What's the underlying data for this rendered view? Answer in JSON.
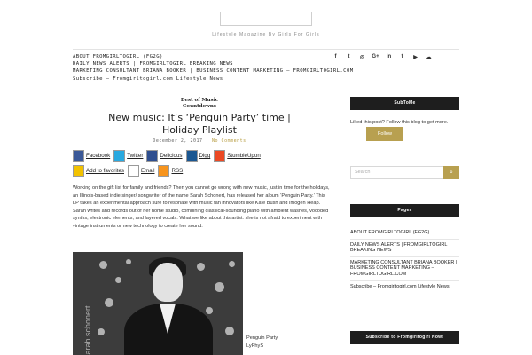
{
  "site": {
    "tagline": "Lifestyle Magazine By Girls For Girls"
  },
  "nav": {
    "links": [
      "ABOUT FROMGIRLTOGIRL (FG2G)",
      "DAILY NEWS ALERTS | FROMGIRLTOGIRL BREAKING NEWS",
      "MARKETING CONSULTANT BRIANA BOOKER | BUSINESS CONTENT MARKETING – FROMGIRLTOGIRL.COM",
      "Subscribe – Fromgirltogirl.com Lifestyle News"
    ],
    "social_icons": [
      "facebook-icon",
      "twitter-icon",
      "instagram-icon",
      "google-plus-icon",
      "linkedin-icon",
      "tumblr-icon",
      "youtube-icon",
      "soundcloud-icon"
    ],
    "social_glyphs": [
      "f",
      "t",
      "◎",
      "G+",
      "in",
      "t",
      "▶",
      "☁"
    ]
  },
  "post": {
    "category_line1": "Best of Music",
    "category_line2": "Countdowns",
    "title_line1": "New music: It’s ‘Penguin Party’ time |",
    "title_line2": "Holiday Playlist",
    "date": "December 2, 2017",
    "comments": "No Comments",
    "body": "Working on the gift list for family and friends? Then you cannot go wrong with new music, just in time for the holidays, an Illinois-based indie singer/ songwriter of the name Sarah Schonert, has released her album ‘Penguin Party.’ This LP takes an experimental approach sure to resonate with music fan innovators like Kate Bush and Imogen Heap. Sarah writes and records out of her home studio, combining classical-sounding piano with ambient washes, vocoded synths, electronic elements, and layered vocals. What we like about this artist: she is not afraid to experiment with vintage instruments or new technology to create her sound.",
    "photo_watermark": "sarah schonert",
    "album_title": "Penguin Party",
    "album_label": "LyPhyS"
  },
  "share": {
    "row1": [
      "Facebook",
      "Twitter",
      "Delicious",
      "Digg",
      "StumbleUpon"
    ],
    "row2": [
      "Add to favorites",
      "Email",
      "RSS"
    ],
    "icon_colors": [
      "#3b5998",
      "#29a9e0",
      "#2f4f8f",
      "#1b5791",
      "#eb4924",
      "#f2c200",
      "#888888",
      "#f7941d"
    ]
  },
  "sidebar": {
    "subtome_heading": "SubToMe",
    "subtome_text": "Liked this post? Follow this blog to get more.",
    "follow_button": "Follow",
    "search_placeholder": "Search",
    "search_button_icon": "search-icon",
    "pages_heading": "Pages",
    "pages": [
      "ABOUT FROMGIRLTOGIRL (FG2G)",
      "DAILY NEWS ALERTS | FROMGIRLTOGIRL BREAKING NEWS",
      "MARKETING CONSULTANT BRIANA BOOKER | BUSINESS CONTENT MARKETING – FROMGIRLTOGIRL.COM",
      "Subscribe – Fromgirltogirl.com Lifestyle News"
    ],
    "subscribe_heading": "Subscribe to Fromgirltogirl Now!"
  },
  "colors": {
    "accent": "#b8a050",
    "dark": "#1e1e1e"
  }
}
